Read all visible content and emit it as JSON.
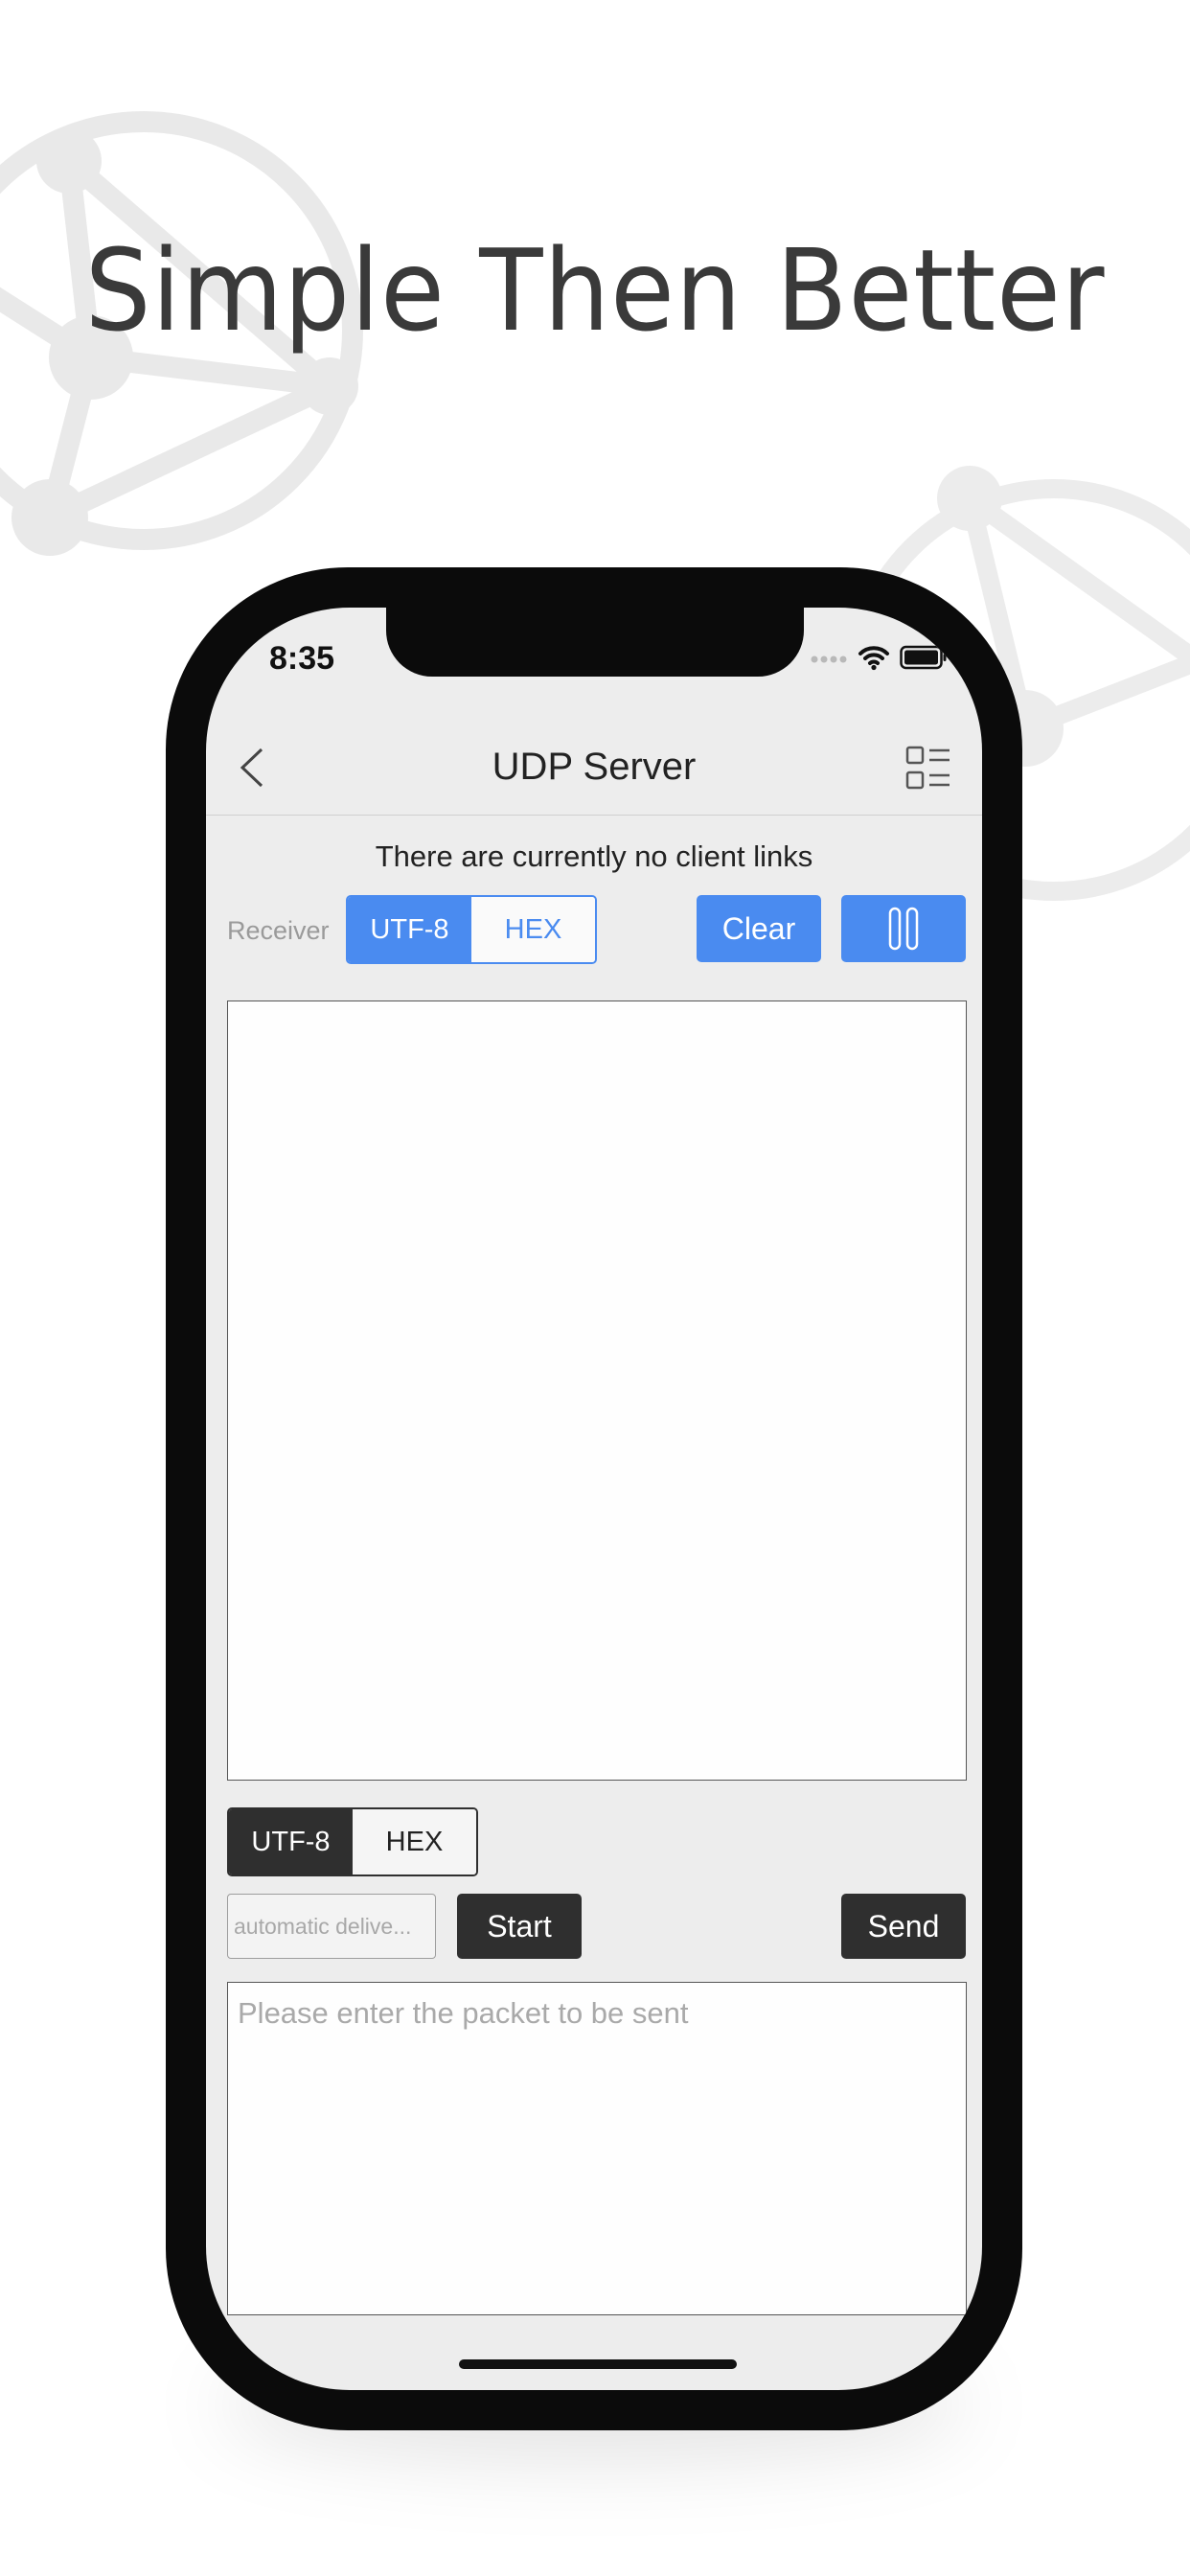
{
  "promo": {
    "tagline": "Simple Then Better"
  },
  "status_bar": {
    "time": "8:35",
    "icons": [
      "cellular-signal-icon",
      "wifi-icon",
      "battery-icon"
    ]
  },
  "nav": {
    "title": "UDP Server",
    "back_icon": "chevron-left-icon",
    "menu_icon": "list-menu-icon"
  },
  "connection_status": "There are currently no client links",
  "receiver": {
    "label": "Receiver",
    "encoding_options": [
      "UTF-8",
      "HEX"
    ],
    "selected_encoding": "UTF-8",
    "clear_label": "Clear",
    "pause_icon": "pause-icon",
    "received_text": ""
  },
  "sender": {
    "encoding_options": [
      "UTF-8",
      "HEX"
    ],
    "selected_encoding": "UTF-8",
    "auto_delivery_placeholder": "automatic delive...",
    "start_label": "Start",
    "send_label": "Send",
    "packet_placeholder": "Please enter the packet to be sent"
  },
  "colors": {
    "accent_blue": "#4a8bf0",
    "dark_button": "#2f2f2f",
    "screen_background": "#ededed",
    "phone_body": "#0b0b0b"
  }
}
